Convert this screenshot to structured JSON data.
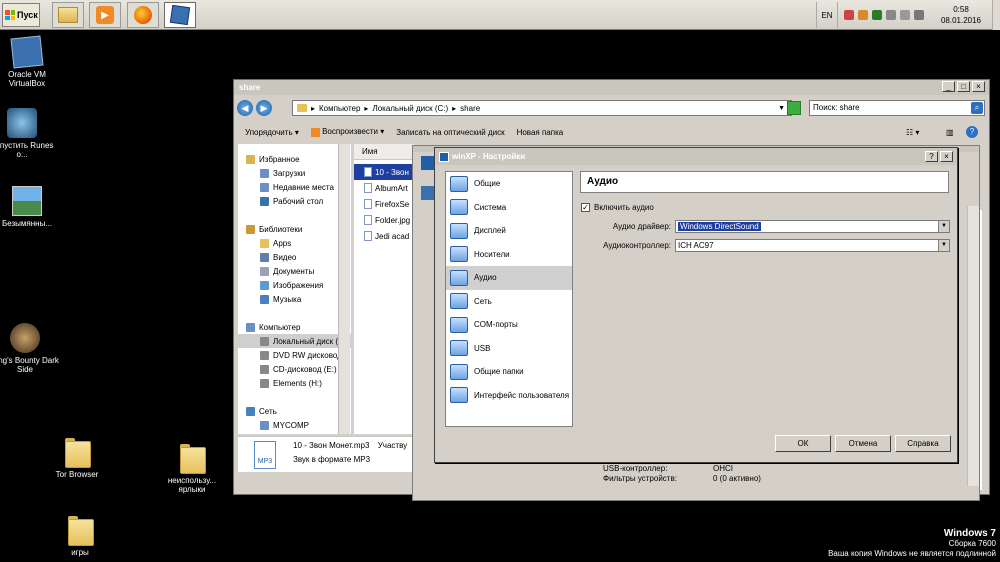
{
  "taskbar": {
    "start_label": "Пуск",
    "apps": [
      "explorer",
      "media-player",
      "firefox",
      "virtualbox"
    ],
    "lang": "EN",
    "time": "0:58",
    "date": "08.01.2016"
  },
  "desktop": {
    "icons": [
      {
        "label": "Oracle VM VirtualBox"
      },
      {
        "label": "Запустить Runes o..."
      },
      {
        "label": "Безымянны..."
      },
      {
        "label": "King's Bounty Dark Side"
      },
      {
        "label": "Tor Browser"
      },
      {
        "label": "неиспользу... ярлыки"
      },
      {
        "label": "игры"
      }
    ],
    "watermark": {
      "line1": "Windows 7",
      "line2": "Сборка 7600",
      "line3": "Ваша копия Windows не является подлинной"
    }
  },
  "explorer": {
    "title": "share",
    "breadcrumb": [
      "Компьютер",
      "Локальный диск (C:)",
      "share"
    ],
    "search_placeholder": "Поиск: share",
    "toolbar": [
      "Упорядочить",
      "Воспроизвести",
      "Записать на оптический диск",
      "Новая папка"
    ],
    "nav": [
      {
        "label": "Избранное",
        "indent": 0,
        "color": "#d8b552"
      },
      {
        "label": "Загрузки",
        "indent": 1,
        "color": "#6b8fc7"
      },
      {
        "label": "Недавние места",
        "indent": 1,
        "color": "#6b8fc7"
      },
      {
        "label": "Рабочий стол",
        "indent": 1,
        "color": "#3a6fb0"
      },
      {
        "label": "",
        "indent": 0,
        "color": ""
      },
      {
        "label": "Библиотеки",
        "indent": 0,
        "color": "#c89a3a"
      },
      {
        "label": "Apps",
        "indent": 1,
        "color": "#e6c15c"
      },
      {
        "label": "Видео",
        "indent": 1,
        "color": "#5f7fb0"
      },
      {
        "label": "Документы",
        "indent": 1,
        "color": "#9aa3b0"
      },
      {
        "label": "Изображения",
        "indent": 1,
        "color": "#5a9bd0"
      },
      {
        "label": "Музыка",
        "indent": 1,
        "color": "#4a80c0"
      },
      {
        "label": "",
        "indent": 0,
        "color": ""
      },
      {
        "label": "Компьютер",
        "indent": 0,
        "color": "#6a8fc0"
      },
      {
        "label": "Локальный диск (",
        "indent": 1,
        "color": "#888",
        "selected": true
      },
      {
        "label": "DVD RW дисковод",
        "indent": 1,
        "color": "#888"
      },
      {
        "label": "CD-дисковод (E:)",
        "indent": 1,
        "color": "#888"
      },
      {
        "label": "Elements (H:)",
        "indent": 1,
        "color": "#888"
      },
      {
        "label": "",
        "indent": 0,
        "color": ""
      },
      {
        "label": "Сеть",
        "indent": 0,
        "color": "#4a7fc0"
      },
      {
        "label": "MYCOMP",
        "indent": 1,
        "color": "#6a8fc0"
      }
    ],
    "column_header": "Имя",
    "files": [
      {
        "name": "10 - Звон",
        "selected": true
      },
      {
        "name": "AlbumArt",
        "selected": false
      },
      {
        "name": "FirefoxSe",
        "selected": false
      },
      {
        "name": "Folder.jpg",
        "selected": false
      },
      {
        "name": "Jedi acad",
        "selected": false
      }
    ],
    "details": {
      "name": "10 - Звон Монет.mp3",
      "extra": "Участву",
      "type": "Звук в формате MP3",
      "icon_label": "MP3"
    }
  },
  "vbox_info": [
    {
      "label": "USB-контроллер:",
      "value": "OHCI"
    },
    {
      "label": "Фильтры устройств:",
      "value": "0 (0 активно)"
    }
  ],
  "dialog": {
    "title": "winXP - Настройки",
    "sidebar": [
      {
        "label": "Общие"
      },
      {
        "label": "Система"
      },
      {
        "label": "Дисплей"
      },
      {
        "label": "Носители"
      },
      {
        "label": "Аудио",
        "selected": true
      },
      {
        "label": "Сеть"
      },
      {
        "label": "COM-порты"
      },
      {
        "label": "USB"
      },
      {
        "label": "Общие папки"
      },
      {
        "label": "Интерфейс пользователя"
      }
    ],
    "section_title": "Аудио",
    "enable_audio_label": "Включить аудио",
    "enable_audio_checked": true,
    "driver_label": "Аудио драйвер:",
    "driver_value": "Windows DirectSound",
    "controller_label": "Аудиоконтроллер:",
    "controller_value": "ICH AC97",
    "buttons": {
      "ok": "ОК",
      "cancel": "Отмена",
      "help": "Справка"
    }
  }
}
